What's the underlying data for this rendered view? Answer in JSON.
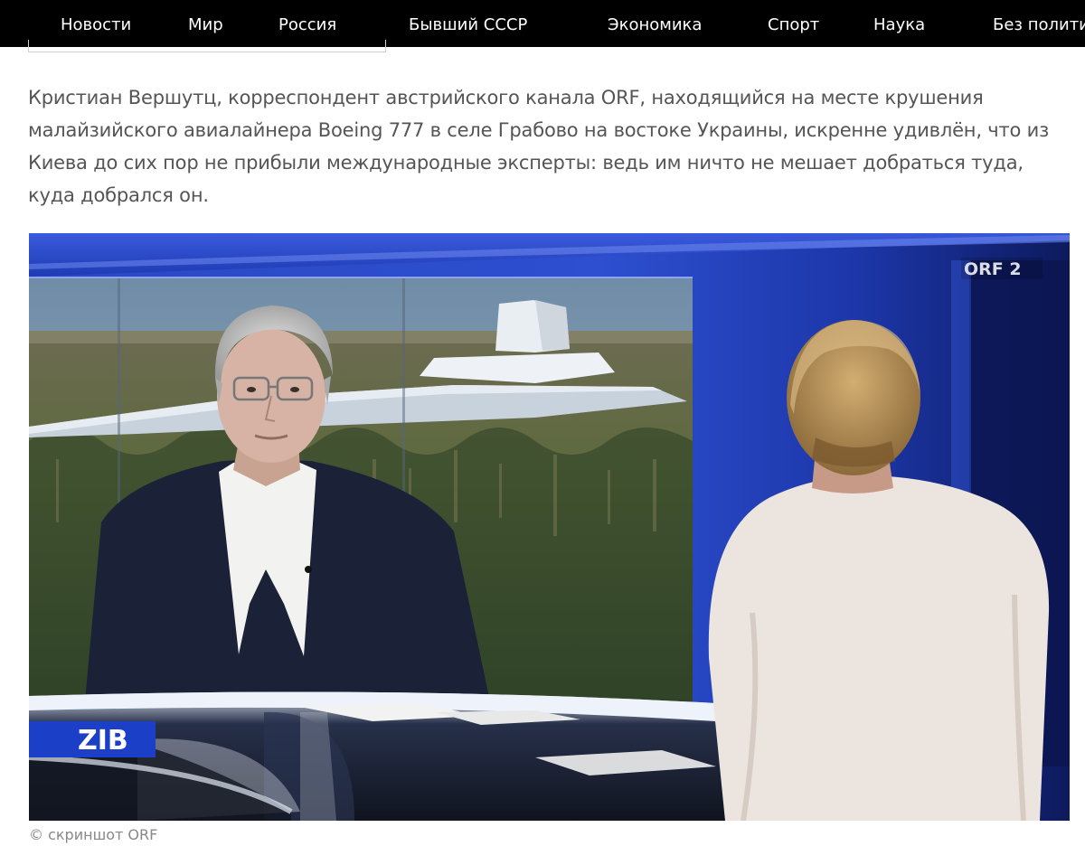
{
  "nav": {
    "items": [
      "Новости",
      "Мир",
      "Россия",
      "Бывший СССР",
      "Экономика",
      "Спорт",
      "Наука",
      "Без полити"
    ]
  },
  "article": {
    "lead": "Кристиан Вершутц, корреспондент австрийского канала ORF, находящийся на месте крушения малайзийского авиалайнера Boeing 777 в селе Грабово на востоке Украины, искренне удивлён, что из Киева до сих пор не прибыли международные эксперты: ведь им ничто не мешает добраться туда, куда добрался он.",
    "image": {
      "channel_logo": "ORF 2",
      "show_logo": "ZIB",
      "caption": "© скриншот ORF"
    }
  },
  "colors": {
    "nav_bg": "#000000",
    "nav_text": "#ffffff",
    "lead_text": "#555555",
    "caption_text": "#888888",
    "studio_blue": "#1f3cb8",
    "zib_blue": "#1b3fc7"
  }
}
